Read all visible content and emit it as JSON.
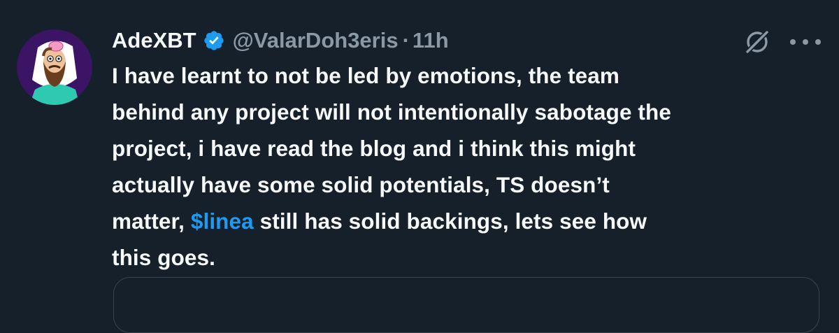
{
  "tweet": {
    "author": {
      "display_name": "AdeXBT",
      "handle": "@ValarDoh3eris",
      "verified": true,
      "avatar_icon": "avatar-illustration"
    },
    "separator": "·",
    "time": "11h",
    "text_lines": [
      "I have learnt to not be led by emotions, the team",
      "behind any project will not intentionally sabotage the",
      "project, i have read the blog and i think this might",
      "actually have some solid potentials, TS doesn’t"
    ],
    "line5_before": "matter, ",
    "cashtag": "$linea",
    "line5_after": " still has solid backings, lets see how",
    "line6": "this goes.",
    "icons": {
      "grok": "grok-icon",
      "more": "more-icon",
      "verified": "verified-badge-icon"
    }
  },
  "colors": {
    "background": "#15202b",
    "text": "#f7f9f9",
    "secondary": "#8b98a5",
    "accent": "#1d9bf0"
  }
}
